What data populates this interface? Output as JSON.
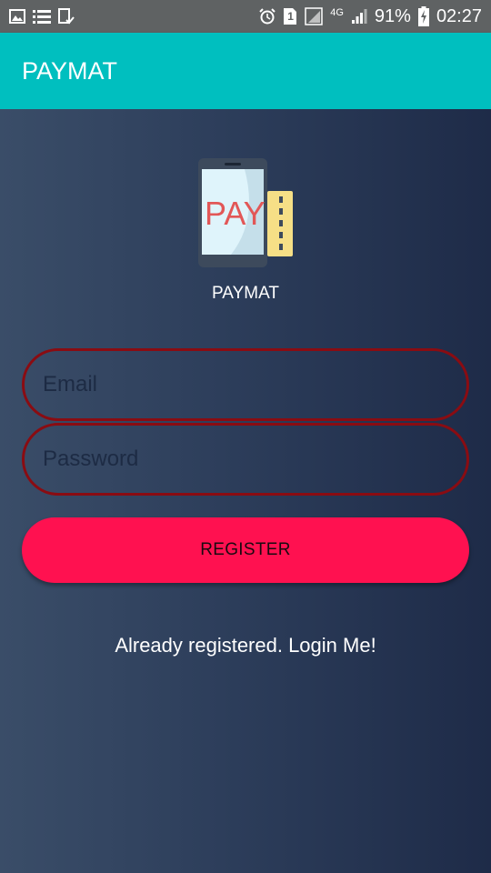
{
  "status_bar": {
    "sim_number": "1",
    "network": "4G",
    "battery": "91%",
    "time": "02:27",
    "icons": [
      "image-icon",
      "list-icon",
      "clipboard-check-icon",
      "alarm-icon",
      "sim-icon",
      "no-signal-icon",
      "signal-icon",
      "battery-charging-icon"
    ]
  },
  "app_bar": {
    "title": "PAYMAT"
  },
  "logo": {
    "icon": "pay-phone-icon",
    "text": "PAY",
    "caption": "PAYMAT"
  },
  "form": {
    "email_placeholder": "Email",
    "password_placeholder": "Password",
    "register_label": "REGISTER",
    "login_link": "Already registered. Login Me!"
  },
  "colors": {
    "app_bar": "#00bfbf",
    "status_bar": "#5f6263",
    "field_border": "#8a0c12",
    "register_button": "#ff1150",
    "background_dark": "#1e2b48"
  }
}
